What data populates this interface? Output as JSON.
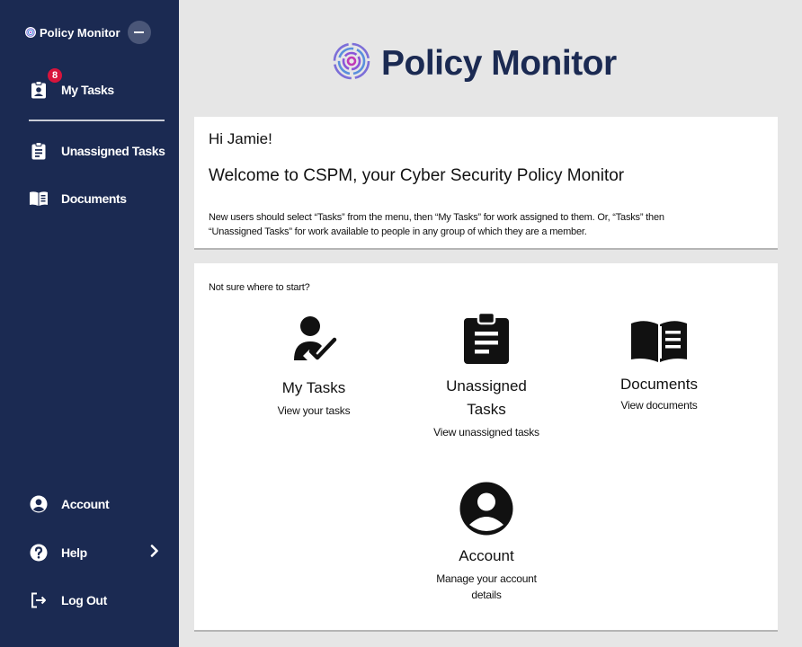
{
  "sidebar": {
    "brand_label": "Policy Monitor",
    "badge_count": "8",
    "items": {
      "my_tasks": "My Tasks",
      "unassigned_tasks": "Unassigned Tasks",
      "documents": "Documents",
      "account": "Account",
      "help": "Help",
      "log_out": "Log Out"
    }
  },
  "header": {
    "logo_text": "Policy Monitor"
  },
  "welcome_card": {
    "greeting": "Hi Jamie!",
    "heading": "Welcome to CSPM, your Cyber Security Policy Monitor",
    "intro_line1": "New users should select “Tasks” from the menu, then “My Tasks” for work assigned to them. Or, “Tasks” then",
    "intro_line2": "“Unassigned Tasks” for work available to people in any group of which they are a member."
  },
  "start_card": {
    "prompt": "Not sure where to start?",
    "tiles": {
      "my_tasks": {
        "title": "My Tasks",
        "desc": "View your tasks"
      },
      "unassigned": {
        "title_line1": "Unassigned",
        "title_line2": "Tasks",
        "desc": "View unassigned tasks"
      },
      "documents": {
        "title": "Documents",
        "desc": "View documents"
      },
      "account": {
        "title": "Account",
        "desc_line1": "Manage your account",
        "desc_line2": "details"
      }
    }
  },
  "colors": {
    "sidebar_bg": "#1b2a52",
    "badge": "#d8143c",
    "page_bg": "#e6e6e6",
    "logo_text": "#1b2a52"
  },
  "icons": {
    "brand": "fingerprint-logo-icon",
    "collapse": "minus-icon",
    "my_tasks": "clipboard-user-icon",
    "unassigned": "clipboard-list-icon",
    "documents": "book-open-icon",
    "account": "user-circle-icon",
    "help": "question-circle-icon",
    "chevron": "chevron-right-icon",
    "log_out": "sign-out-icon"
  }
}
